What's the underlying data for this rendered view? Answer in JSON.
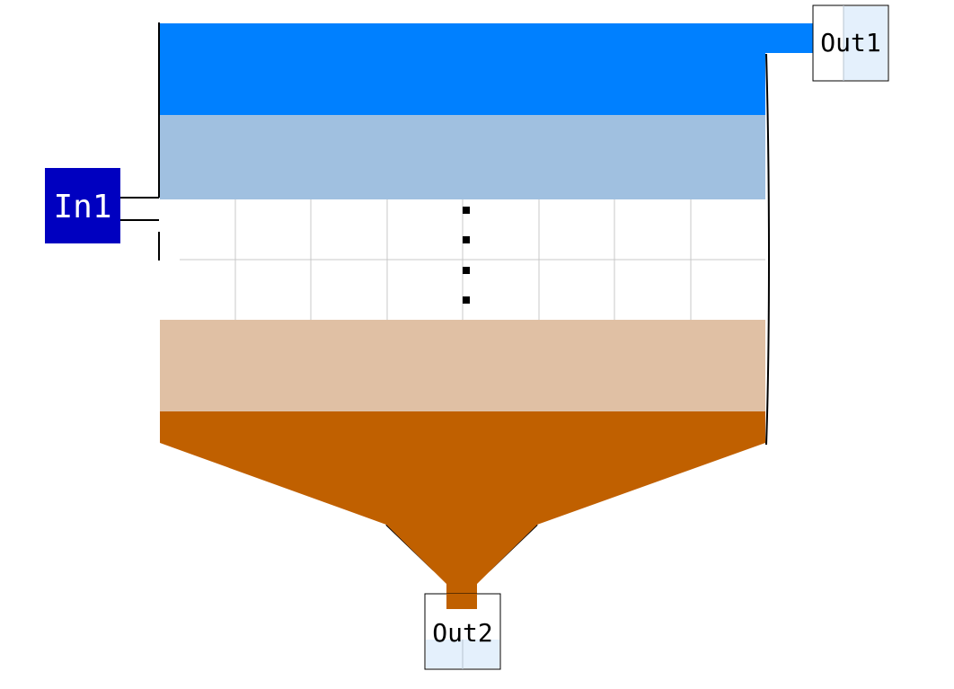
{
  "diagram": {
    "ports": {
      "in1": {
        "label": "In1",
        "fill": "#0000C0",
        "text_color": "#FFFFFF"
      },
      "out1": {
        "label": "Out1",
        "fill": "#FFFFFF",
        "text_color": "#000000"
      },
      "out2": {
        "label": "Out2",
        "fill": "#FFFFFF",
        "text_color": "#000000"
      }
    },
    "layers": [
      {
        "id": "top-layer",
        "color": "#0080FF"
      },
      {
        "id": "light-blue-layer",
        "color": "#A0C0E0"
      },
      {
        "id": "middle-white-layer",
        "color": "#FFFFFF"
      },
      {
        "id": "tan-layer",
        "color": "#E0C0A4"
      },
      {
        "id": "bottom-layer",
        "color": "#C06000"
      }
    ],
    "colors": {
      "outline": "#000000",
      "grid": "#C8C8C8",
      "port_shade": "#E4F0FC"
    }
  }
}
